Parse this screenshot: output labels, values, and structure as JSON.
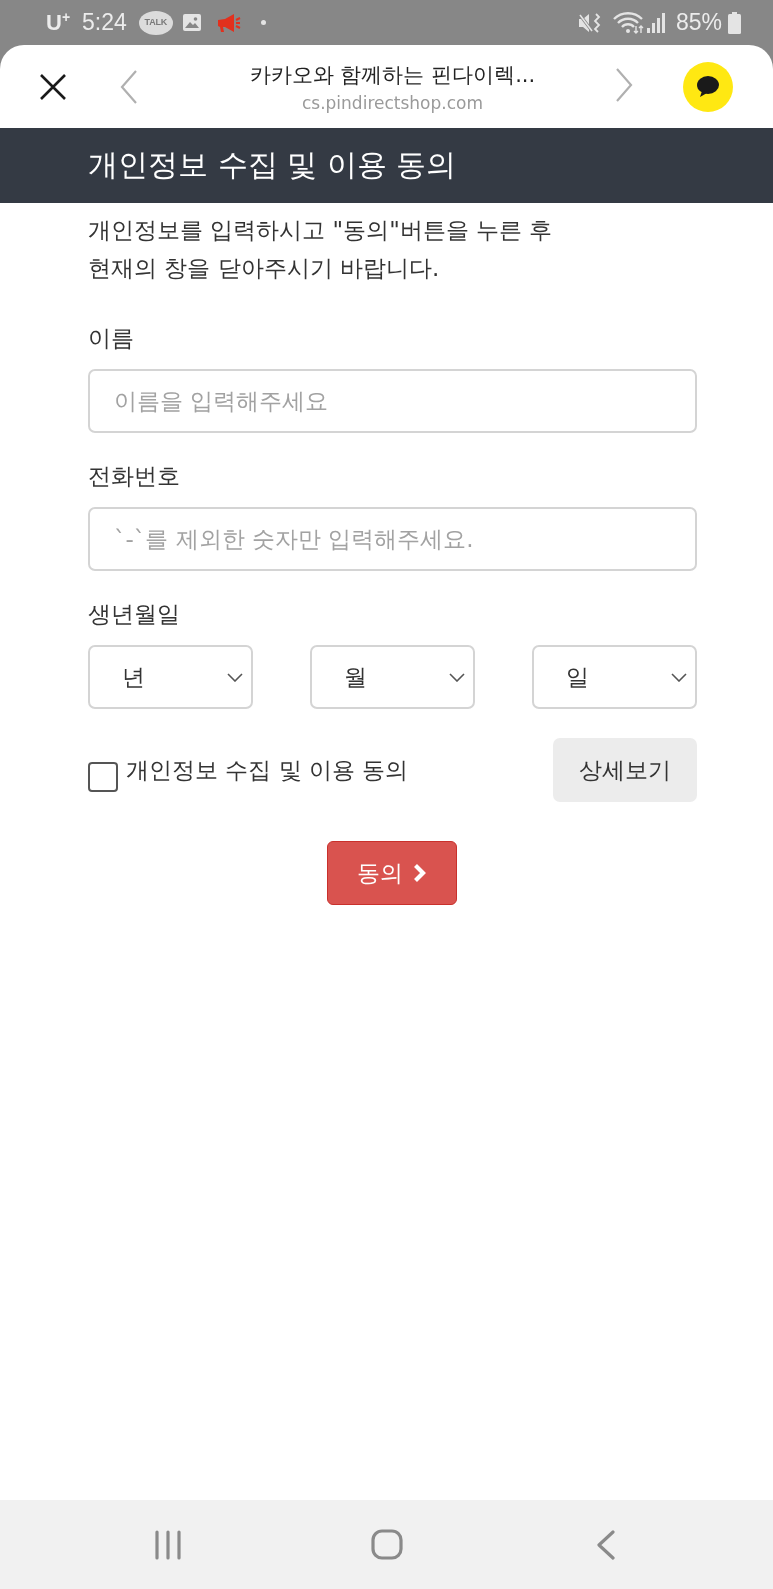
{
  "status_bar": {
    "carrier": "U$^{+}$",
    "time": "5:24",
    "talk_badge": "TALK",
    "battery": "85%"
  },
  "browser_bar": {
    "title": "카카오와 함께하는 핀다이렉...",
    "url": "cs.pindirectshop.com"
  },
  "header": {
    "title": "개인정보 수집 및 이용 동의"
  },
  "form": {
    "description": [
      "개인정보를 입력하시고 \"동의\"버튼을 누른 후",
      "현재의 창을 닫아주시기 바랍니다."
    ],
    "fields": [
      {
        "kind": "text",
        "label": "이름",
        "placeholder": "이름을 입력해주세요"
      },
      {
        "kind": "text",
        "label": "전화번호",
        "placeholder": "`-`를 제외한 숫자만 입력해주세요."
      },
      {
        "kind": "date",
        "label": "생년월일",
        "selects": [
          {
            "value": "년"
          },
          {
            "value": "월"
          },
          {
            "value": "일"
          }
        ]
      }
    ],
    "consent": {
      "label": "개인정보 수집 및 이용 동의",
      "checked": false,
      "details_button": "상세보기"
    },
    "submit_button": "동의"
  }
}
